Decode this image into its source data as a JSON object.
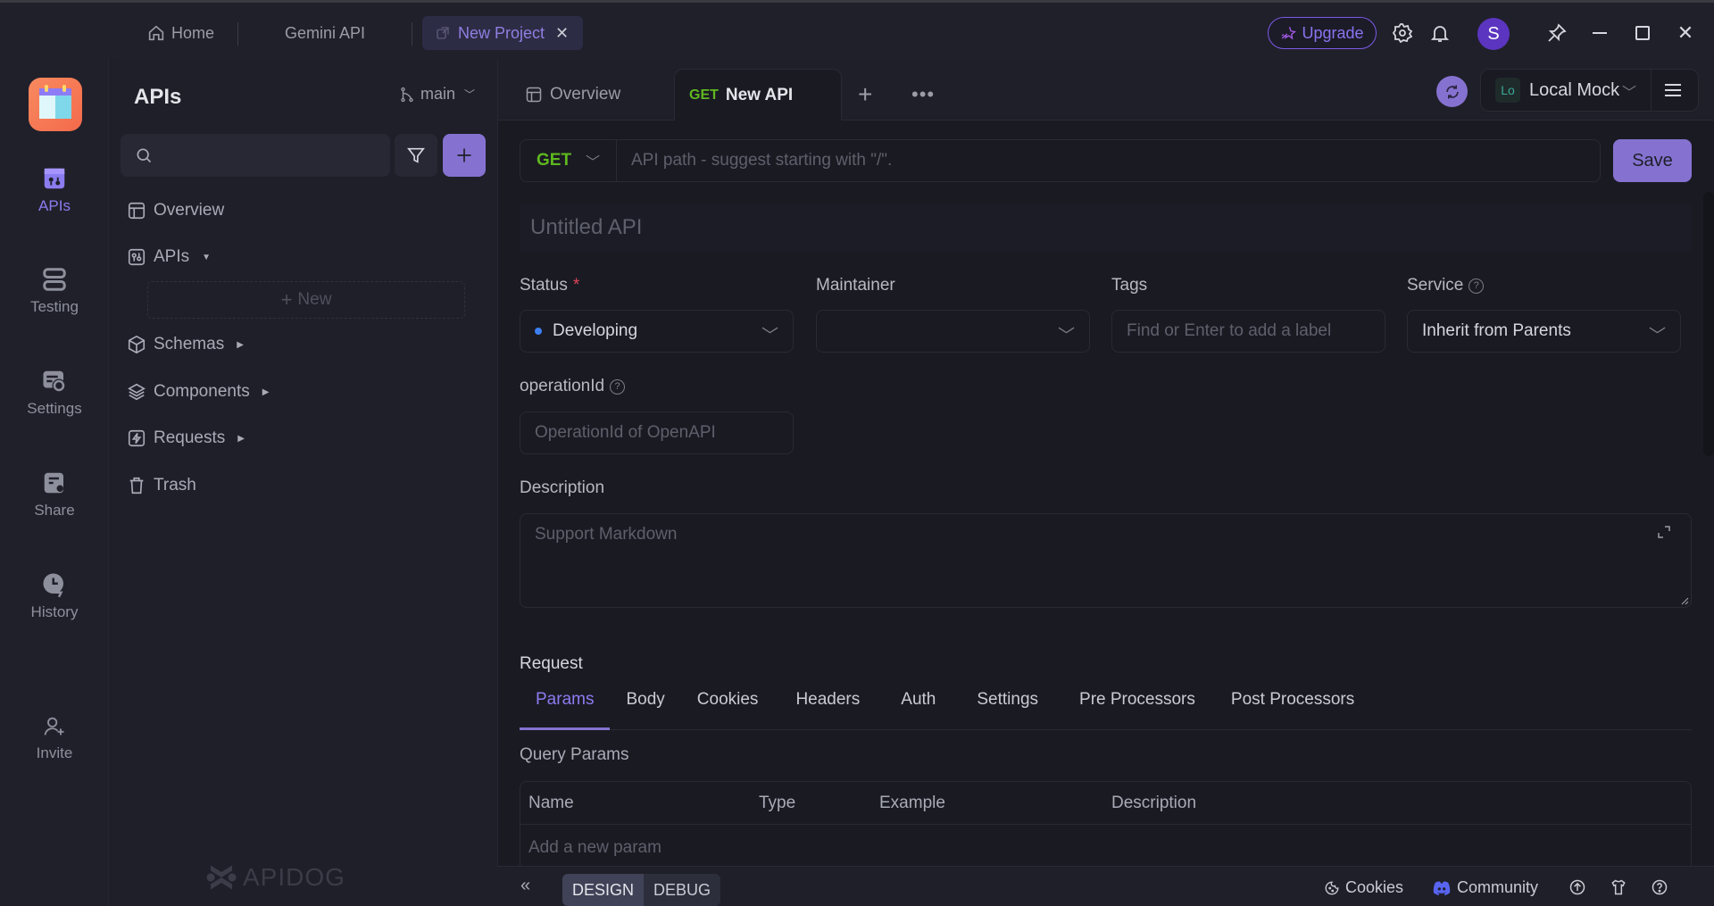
{
  "titlebar": {
    "tabs": [
      {
        "label": "Home",
        "icon": "home-icon"
      },
      {
        "label": "Gemini API"
      },
      {
        "label": "New Project",
        "icon": "external-link-icon",
        "active": true
      }
    ],
    "upgrade_label": "Upgrade",
    "avatar_initial": "S"
  },
  "rail": {
    "items": [
      {
        "label": "APIs",
        "active": true
      },
      {
        "label": "Testing"
      },
      {
        "label": "Settings"
      },
      {
        "label": "Share"
      },
      {
        "label": "History"
      },
      {
        "label": "Invite"
      }
    ]
  },
  "sidebar": {
    "title": "APIs",
    "branch": "main",
    "search_placeholder": "",
    "tree": [
      {
        "label": "Overview"
      },
      {
        "label": "APIs",
        "expanded": true
      },
      {
        "label": "Schemas"
      },
      {
        "label": "Components"
      },
      {
        "label": "Requests"
      },
      {
        "label": "Trash"
      }
    ],
    "new_label": "New",
    "brand": "APIDOG"
  },
  "main": {
    "tabs": [
      {
        "label": "Overview"
      },
      {
        "method": "GET",
        "label": "New API",
        "active": true
      }
    ],
    "environment": {
      "badge": "Lo",
      "name": "Local Mock"
    },
    "method": "GET",
    "url_placeholder": "API path - suggest starting with \"/\".",
    "save_label": "Save",
    "title_placeholder": "Untitled API",
    "fields": {
      "status_label": "Status",
      "status_required": "*",
      "status_value": "Developing",
      "maintainer_label": "Maintainer",
      "maintainer_value": "",
      "tags_label": "Tags",
      "tags_placeholder": "Find or Enter to add a label",
      "service_label": "Service",
      "service_value": "Inherit from Parents",
      "operation_label": "operationId",
      "operation_placeholder": "OperationId of OpenAPI",
      "description_label": "Description",
      "description_placeholder": "Support Markdown"
    },
    "request": {
      "title": "Request",
      "tabs": [
        "Params",
        "Body",
        "Cookies",
        "Headers",
        "Auth",
        "Settings",
        "Pre Processors",
        "Post Processors"
      ],
      "active_tab": "Params",
      "query_title": "Query Params",
      "columns": [
        "Name",
        "Type",
        "Example",
        "Description"
      ],
      "add_param": "Add a new param"
    }
  },
  "bottombar": {
    "modes": [
      "DESIGN",
      "DEBUG"
    ],
    "active_mode": "DESIGN",
    "cookies": "Cookies",
    "community": "Community"
  },
  "colors": {
    "accent": "#8572d0",
    "get_method": "#5fb81f",
    "status_dot": "#3d7ff0",
    "required": "#e0455a"
  }
}
